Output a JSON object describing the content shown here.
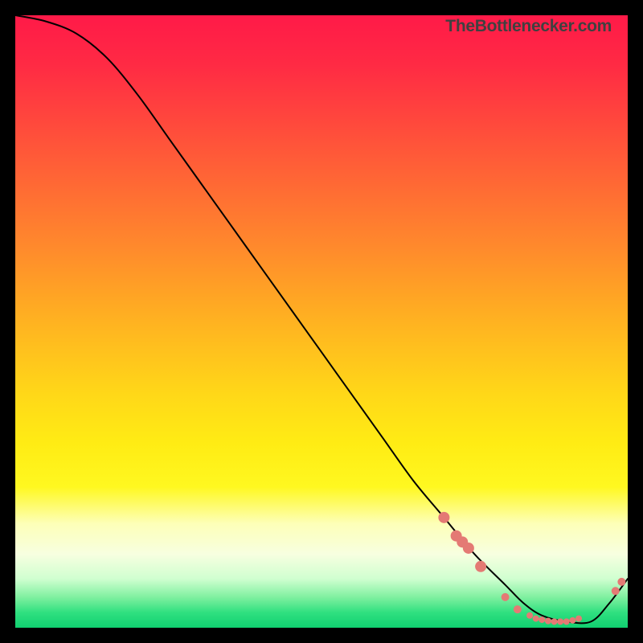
{
  "attribution": "TheBottlenecker.com",
  "chart_data": {
    "type": "line",
    "title": "",
    "xlabel": "",
    "ylabel": "",
    "xlim": [
      0,
      100
    ],
    "ylim": [
      0,
      100
    ],
    "series": [
      {
        "name": "curve",
        "x": [
          0,
          5,
          10,
          15,
          20,
          25,
          30,
          35,
          40,
          45,
          50,
          55,
          60,
          65,
          70,
          75,
          80,
          83,
          86,
          90,
          94,
          97,
          100
        ],
        "y": [
          100,
          99,
          97,
          93,
          87,
          80,
          73,
          66,
          59,
          52,
          45,
          38,
          31,
          24,
          18,
          12,
          7,
          4,
          2,
          1,
          1,
          4,
          8
        ]
      }
    ],
    "markers": [
      {
        "x": 70,
        "y": 18
      },
      {
        "x": 72,
        "y": 15
      },
      {
        "x": 73,
        "y": 14
      },
      {
        "x": 74,
        "y": 13
      },
      {
        "x": 76,
        "y": 10
      },
      {
        "x": 80,
        "y": 5
      },
      {
        "x": 82,
        "y": 3
      },
      {
        "x": 84,
        "y": 2
      },
      {
        "x": 85,
        "y": 1.5
      },
      {
        "x": 86,
        "y": 1.3
      },
      {
        "x": 87,
        "y": 1.1
      },
      {
        "x": 88,
        "y": 1.0
      },
      {
        "x": 89,
        "y": 1.0
      },
      {
        "x": 90,
        "y": 1.0
      },
      {
        "x": 91,
        "y": 1.2
      },
      {
        "x": 92,
        "y": 1.5
      },
      {
        "x": 98,
        "y": 6
      },
      {
        "x": 99,
        "y": 7.5
      }
    ],
    "marker_color": "#e47a74",
    "curve_color": "#000000"
  }
}
